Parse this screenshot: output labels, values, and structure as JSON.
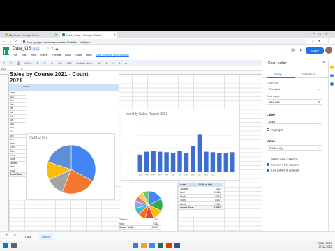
{
  "browser": {
    "tabs": [
      {
        "label": "My Drive - Google Drive"
      },
      {
        "label": "Data_Chart - Google Sheets"
      },
      {
        "label": ""
      }
    ],
    "url": "docs.google.com/spreadsheets/d/1eK6m...edit#gid=..."
  },
  "sheets": {
    "doc_title": "Data_GS",
    "doc_badge": "XLSX",
    "menus": [
      "File",
      "Edit",
      "View",
      "Insert",
      "Format",
      "Data",
      "Tools",
      "Help"
    ],
    "last_edit": "Last edit was seconds ago",
    "share_label": "Share",
    "toolbar_items": [
      "100%",
      "$",
      "%",
      ".0",
      ".00",
      "123",
      "Default (Ari...",
      "10",
      "B",
      "I",
      "S",
      "A"
    ],
    "name_box": "E25",
    "fx": "fx"
  },
  "table": {
    "title": "Sales by Course 2021 - Count",
    "subtitle": "2021",
    "header_label": "Course",
    "rows": [
      "Amer",
      "Aug",
      "Dec",
      "Feb",
      "Jan",
      "Jul",
      "Jun",
      "Mar",
      "May",
      "Nov",
      "Oct",
      "Sep",
      "Rec.",
      "Basic",
      "Gold",
      "Silver",
      "Excel",
      "Kaval",
      "Tableau",
      "Java",
      "Vlook",
      "Grand Total"
    ],
    "bottom_values": [
      "9758  4841  9960  4895  1614  4003  10778  47997",
      ""
    ]
  },
  "pie_chart_large": {
    "title": "SUM of Qty",
    "labels": [
      "",
      "",
      "",
      ""
    ]
  },
  "bar_chart": {
    "title": "Monthly Sales Report 2021",
    "x_axis_title": "",
    "y_axis_title": ""
  },
  "pie_chart_small": {
    "labels": [
      "",
      ""
    ]
  },
  "summary_table": {
    "header_left": "Area",
    "header_right": "SUM of Qty",
    "rows": [
      {
        "label": "Central",
        "value": "7342"
      },
      {
        "label": "East",
        "value": "11446"
      },
      {
        "label": "North",
        "value": "5923"
      },
      {
        "label": "South",
        "value": "8437"
      },
      {
        "label": "West",
        "value": "5947"
      }
    ],
    "total_label": "Grand Total",
    "total_value": "41997"
  },
  "small_table": {
    "rows": [
      {
        "label": "Tableau",
        "value": "4162"
      },
      {
        "label": "Vdot",
        "value": "5152"
      },
      {
        "label": "Grand Total",
        "value": "42997"
      }
    ]
  },
  "sheet_tabs": [
    "Data",
    "Report"
  ],
  "editor": {
    "title": "Chart editor",
    "tab_setup": "Setup",
    "tab_customize": "Customize",
    "chart_type_label": "Chart type",
    "chart_type_value": "Pie chart",
    "data_range_label": "Data range",
    "data_range_value": "B15:C22",
    "label_section": "Label",
    "label_value": "Area",
    "aggregate_label": "Aggregate",
    "value_section": "Value",
    "value_value": "SUM of Qty",
    "checkboxes": [
      {
        "label": "Switch rows / columns",
        "checked": false
      },
      {
        "label": "Use row 14 as headers",
        "checked": true
      },
      {
        "label": "Use column B as labels",
        "checked": true
      }
    ]
  },
  "taskbar": {
    "time": "09:20",
    "date": "27-12-2021",
    "lang": "ENG"
  },
  "chart_data": [
    {
      "type": "pie",
      "title": "SUM of Qty",
      "series": [
        {
          "values": [
            33,
            23,
            12,
            12,
            20
          ]
        }
      ],
      "colors": [
        "#4285f4",
        "#f4792e",
        "#a4a4a4",
        "#fbbc04",
        "#5b8fd6"
      ]
    },
    {
      "type": "bar",
      "title": "Monthly Sales Report 2021",
      "categories": [
        "JAN",
        "FEB",
        "MAR",
        "APR",
        "MAY",
        "JUN",
        "JUL",
        "AUG",
        "SEP",
        "OCT",
        "NOV",
        "DEC"
      ],
      "series": [
        {
          "values": [
            3600,
            4200,
            4300,
            4200,
            4100,
            4000,
            4300,
            3900,
            5300,
            7800,
            4200,
            4100,
            4000,
            3900,
            4100
          ]
        }
      ],
      "categories_full": [
        "JAN",
        "FEB",
        "MAR",
        "APR",
        "MAY",
        "JUN",
        "JUL",
        "AUG",
        "SEP",
        "OCT",
        "NOV",
        "DEC",
        "",
        "",
        ""
      ],
      "ylim": [
        0,
        10000
      ],
      "color": "#3c6fd1"
    },
    {
      "type": "pie",
      "series": [
        {
          "values": [
            18,
            14,
            12,
            10,
            9,
            8,
            8,
            7,
            7,
            7
          ]
        }
      ],
      "colors": [
        "#4285f4",
        "#34a853",
        "#fbbc04",
        "#ea4335",
        "#ff6d01",
        "#46bdc6",
        "#7baaf7",
        "#f07b72",
        "#fcd04f",
        "#71c287"
      ]
    }
  ]
}
